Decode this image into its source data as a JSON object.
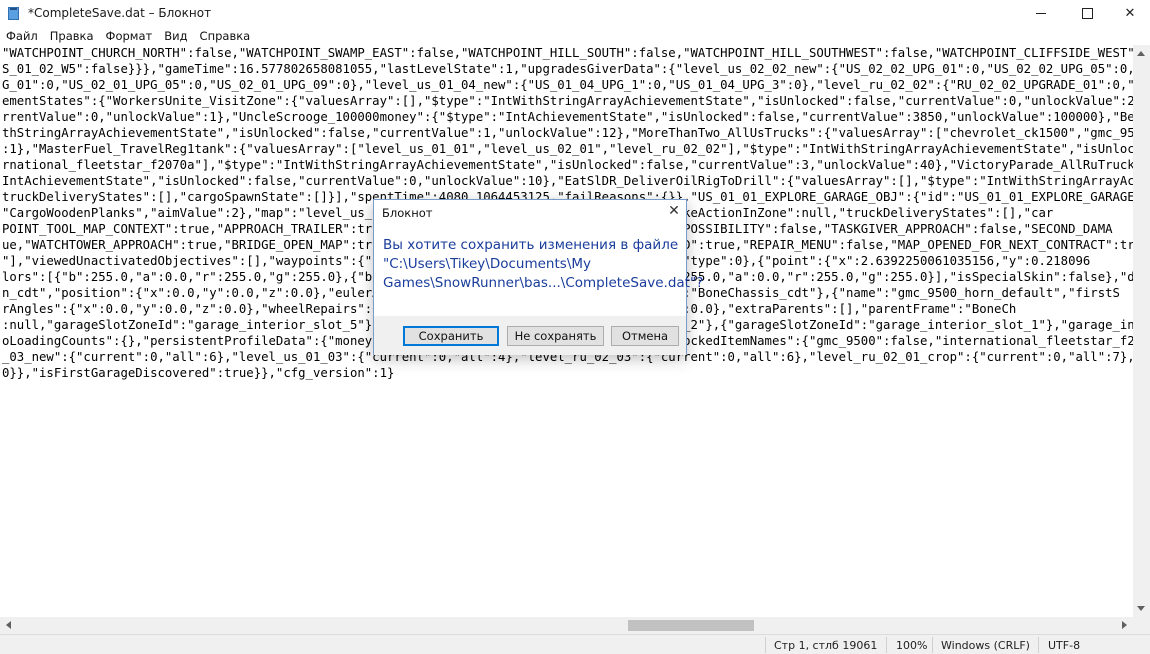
{
  "window": {
    "title": "*CompleteSave.dat – Блокнот",
    "controls": {
      "minimize": "—",
      "maximize": "☐",
      "close": "✕"
    }
  },
  "menu": {
    "items": [
      "Файл",
      "Правка",
      "Формат",
      "Вид",
      "Справка"
    ]
  },
  "editor": {
    "lines": [
      "\"WATCHPOINT_CHURCH_NORTH\":false,\"WATCHPOINT_SWAMP_EAST\":false,\"WATCHPOINT_HILL_SOUTH\":false,\"WATCHPOINT_HILL_SOUTHWEST\":false,\"WATCHPOINT_CLIFFSIDE_WEST\":fals",
      "S_01_02_W5\":false}}},\"gameTime\":16.577802658081055,\"lastLevelState\":1,\"upgradesGiverData\":{\"level_us_02_02_new\":{\"US_02_02_UPG_01\":0,\"US_02_02_UPG_05\":0,\"US_0",
      "G_01\":0,\"US_02_01_UPG_05\":0,\"US_02_01_UPG_09\":0},\"level_us_01_04_new\":{\"US_01_04_UPG_1\":0,\"US_01_04_UPG_3\":0},\"level_ru_02_02\":{\"RU_02_02_UPGRADE_01\":0,\"RU_02",
      "ementStates\":{\"WorkersUnite_VisitZone\":{\"valuesArray\":[],\"$type\":\"IntWithStringArrayAchievementState\",\"isUnlocked\":false,\"currentValue\":0,\"unlockValue\":2},\"Fa",
      "rrentValue\":0,\"unlockValue\":1},\"UncleScrooge_100000money\":{\"$type\":\"IntAchievementState\",\"isUnlocked\":false,\"currentValue\":3850,\"unlockValue\":100000},\"BearHun",
      "thStringArrayAchievementState\",\"isUnlocked\":false,\"currentValue\":1,\"unlockValue\":12},\"MoreThanTwo_AllUsTrucks\":{\"valuesArray\":[\"chevrolet_ck1500\",\"gmc_9500\",\"",
      ":1},\"MasterFuel_TravelReg1tank\":{\"valuesArray\":[\"level_us_01_01\",\"level_us_02_01\",\"level_ru_02_02\"],\"$type\":\"IntWithStringArrayAchievementState\",\"isUnlocked\":",
      "rnational_fleetstar_f2070a\"],\"$type\":\"IntWithStringArrayAchievementState\",\"isUnlocked\":false,\"currentValue\":3,\"unlockValue\":40},\"VictoryParade_AllRuTrucks\":{\"",
      "IntAchievementState\",\"isUnlocked\":false,\"currentValue\":0,\"unlockValue\":10},\"EatSlDR_DeliverOilRigToDrill\":{\"valuesArray\":[],\"$type\":\"IntWithStringArrayAchieve",
      "truckDeliveryStates\":[],\"cargoSpawnState\":[]}],\"spentTime\":4080.1064453125,\"failReasons\":{}},\"US_01_01_EXPLORE_GARAGE_OBJ\":{\"id\":\"US_01_01_EXPLORE_GARAGE_OBJ\"",
      "\"CargoWoodenPlanks\",\"aimValue\":2},\"map\":\"level_us_01_01\",\"zoneName\":\"\",\"cargoState\":null,\"makeActionInZone\":null,\"truckDeliveryStates\":[],\"car",
      "POINT_TOOL_MAP_CONTEXT\":true,\"APPROACH_TRAILER\":true,\"FIRST_CONTRACT_ACCEPTED\":true,\"REPAIR_POSSIBILITY\":false,\"TASKGIVER_APPROACH\":false,\"SECOND_DAMA",
      "ue,\"WATCHTOWER_APPROACH\":true,\"BRIDGE_OPEN_MAP\":true,\"UPGRADE_MAP_OPENED\":true,\"GARAGE_OPENED\":true,\"REPAIR_MENU\":false,\"MAP_OPENED_FOR_NEXT_CONTRACT\":tru",
      "\"],\"viewedUnactivatedObjectives\":[],\"waypoints\":{\"level_us_01_01\":{\"x\":0.0,\"y\":0.0,\"z\":0.0},\"type\":0},{\"point\":{\"x\":2.6392250061035156,\"y\":0.218096",
      "lors\":[{\"b\":255.0,\"a\":0.0,\"r\":255.0,\"g\":255.0},{\"b\":255.0,\"a\":0.0,\"r\":255.0,\"g\":255.0},{\"b\":255.0,\"a\":0.0,\"r\":255.0,\"g\":255.0}],\"isSpecialSkin\":false},\"damage",
      "n_cdt\",\"position\":{\"x\":0.0,\"y\":0.0,\"z\":0.0},\"eulerAngles\":{\"x\":0.0,\"y\":0.0,\"z\":0.0}},{\"name\":\"BoneChassis_cdt\"},{\"name\":\"gmc_9500_horn_default\",\"firstS",
      "rAngles\":{\"x\":0.0,\"y\":0.0,\"z\":0.0},\"wheelRepairs\":0,\"wheelsType\":\"\",\"z\":0.05000057220459,\"z\":0.0},\"extraParents\":[],\"parentFrame\":\"BoneCh",
      ":null,\"garageSlotZoneId\":\"garage_interior_slot_5\"},{\"garageSlotZoneId\":\"garage_interior_slot_2\"},{\"garageSlotZoneId\":\"garage_interior_slot_1\"},\"garage_interior_sl",
      "oLoadingCounts\":{},\"persistentProfileData\":{\"money\":3850,\"refundMoney\":0,\"experience\":0,\"unlockedItemNames\":{\"gmc_9500\":false,\"international_fleetstar_f20",
      "_03_new\":{\"current\":0,\"all\":6},\"level_us_01_03\":{\"current\":0,\"all\":4},\"level_ru_02_03\":{\"current\":0,\"all\":6},\"level_ru_02_01_crop\":{\"current\":0,\"all\":7},\"leve",
      "0}},\"isFirstGarageDiscovered\":true}},\"cfg_version\":1}"
    ]
  },
  "status": {
    "position": "Стр 1, стлб 19061",
    "zoom": "100%",
    "line_ending": "Windows (CRLF)",
    "encoding": "UTF-8"
  },
  "dialog": {
    "title": "Блокнот",
    "close": "✕",
    "message": "Вы хотите сохранить изменения в файле \"C:\\Users\\Tikey\\Documents\\My Games\\SnowRunner\\bas...\\CompleteSave.dat\"?",
    "buttons": {
      "save": "Сохранить",
      "dont_save": "Не сохранять",
      "cancel": "Отмена"
    }
  }
}
